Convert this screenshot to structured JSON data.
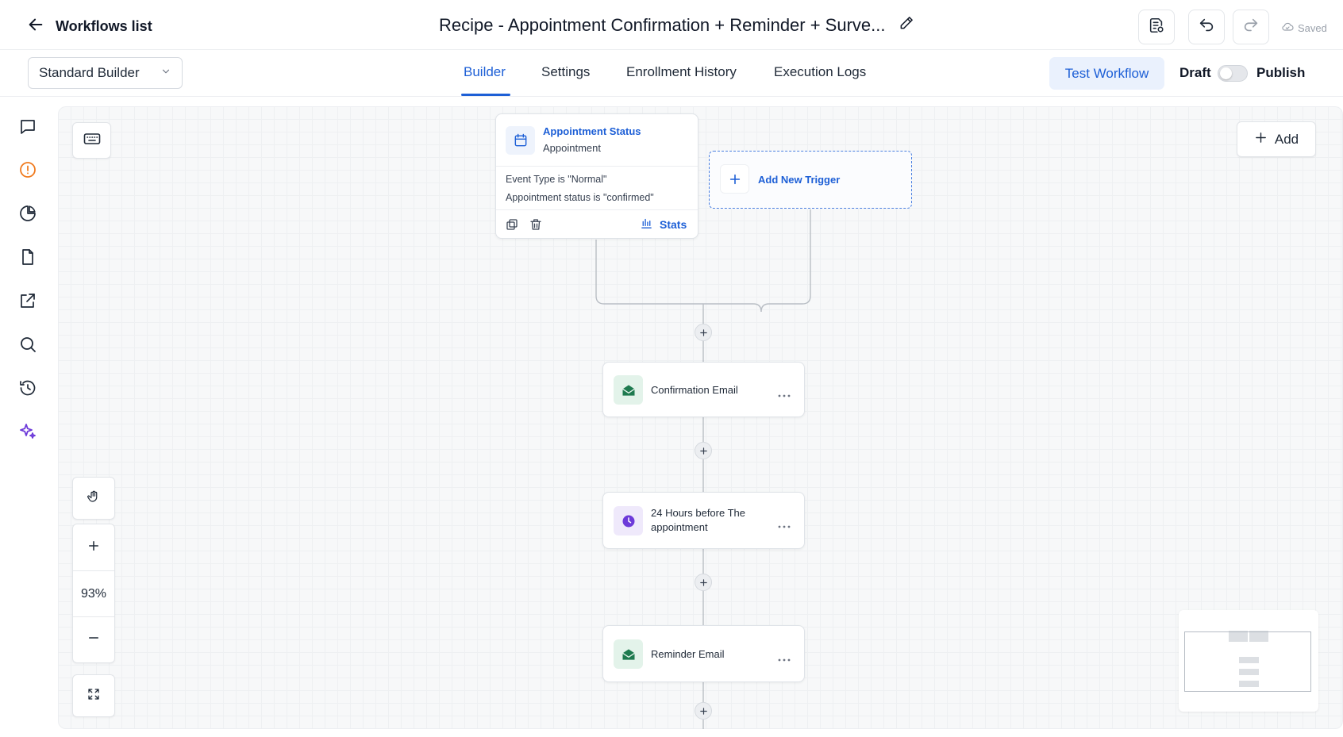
{
  "header": {
    "back_label": "Workflows list",
    "workflow_title": "Recipe - Appointment Confirmation + Reminder + Surve...",
    "saved_label": "Saved"
  },
  "subheader": {
    "builder_mode": "Standard Builder",
    "tabs": [
      {
        "label": "Builder",
        "active": true
      },
      {
        "label": "Settings",
        "active": false
      },
      {
        "label": "Enrollment History",
        "active": false
      },
      {
        "label": "Execution Logs",
        "active": false
      }
    ],
    "test_workflow_label": "Test Workflow",
    "draft_label": "Draft",
    "publish_label": "Publish",
    "publish_on": false
  },
  "sidebar": {
    "items": [
      {
        "icon": "message-icon"
      },
      {
        "icon": "alert-circle-icon",
        "color": "#f07b1f"
      },
      {
        "icon": "pie-chart-icon"
      },
      {
        "icon": "document-icon"
      },
      {
        "icon": "external-link-icon"
      },
      {
        "icon": "search-icon"
      },
      {
        "icon": "history-icon"
      },
      {
        "icon": "sparkles-icon",
        "color": "#6d3ad9"
      }
    ]
  },
  "canvas": {
    "add_label": "Add",
    "zoom_level": "93%",
    "trigger": {
      "title": "Appointment Status",
      "subtitle": "Appointment",
      "conditions": [
        "Event Type is \"Normal\"",
        "Appointment status is \"confirmed\""
      ],
      "stats_label": "Stats"
    },
    "add_trigger_label": "Add New Trigger",
    "actions": [
      {
        "label": "Confirmation Email",
        "icon": "mail-open-icon",
        "color": "#1e7a4f",
        "bg": "#e3f3ea"
      },
      {
        "label": "24 Hours before The appointment",
        "icon": "clock-icon",
        "color": "#6d3ad9",
        "bg": "#efe9fb"
      },
      {
        "label": "Reminder Email",
        "icon": "mail-open-icon",
        "color": "#1e7a4f",
        "bg": "#e3f3ea"
      }
    ]
  },
  "colors": {
    "accent": "#1d5fd6",
    "accent_bg": "#eaf1fd"
  }
}
